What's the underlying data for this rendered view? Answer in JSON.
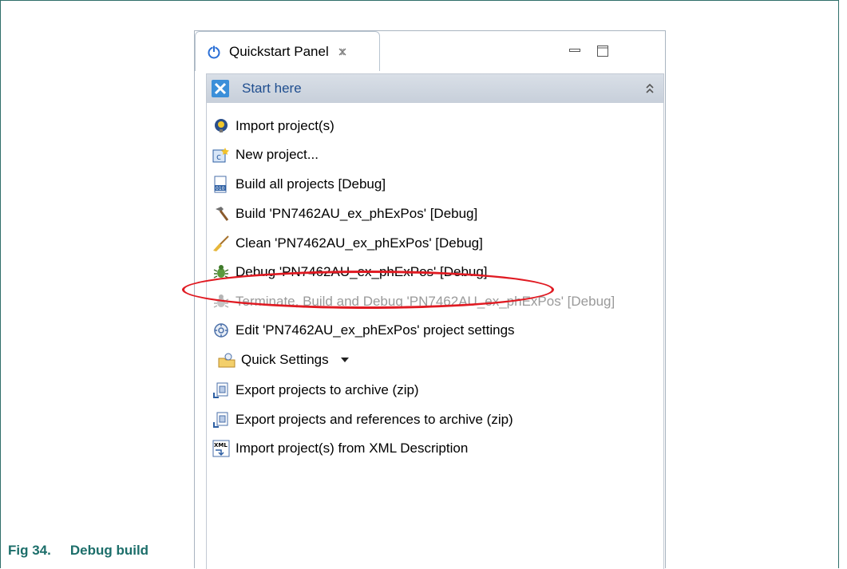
{
  "panel": {
    "tab_label": "Quickstart Panel",
    "section_label": "Start here",
    "items": [
      {
        "label": "Import project(s)",
        "icon": "import-bulb-icon",
        "disabled": false
      },
      {
        "label": "New project...",
        "icon": "new-project-icon",
        "disabled": false
      },
      {
        "label": "Build all projects [Debug]",
        "icon": "build-all-icon",
        "disabled": false
      },
      {
        "label": "Build 'PN7462AU_ex_phExPos' [Debug]",
        "icon": "hammer-icon",
        "disabled": false
      },
      {
        "label": "Clean 'PN7462AU_ex_phExPos' [Debug]",
        "icon": "broom-icon",
        "disabled": false
      },
      {
        "label": "Debug 'PN7462AU_ex_phExPos' [Debug]",
        "icon": "debug-bug-icon",
        "disabled": false
      },
      {
        "label": "Terminate, Build and Debug 'PN7462AU_ex_phExPos' [Debug]",
        "icon": "terminate-debug-icon",
        "disabled": true
      },
      {
        "label": "Edit 'PN7462AU_ex_phExPos' project settings",
        "icon": "settings-icon",
        "disabled": false
      },
      {
        "label": "Quick Settings",
        "icon": "quick-settings-icon",
        "disabled": false
      },
      {
        "label": "Export projects to archive (zip)",
        "icon": "export-archive-icon",
        "disabled": false
      },
      {
        "label": "Export projects and references to archive (zip)",
        "icon": "export-references-icon",
        "disabled": false
      },
      {
        "label": "Import project(s) from XML Description",
        "icon": "xml-import-icon",
        "disabled": false
      }
    ]
  },
  "caption": {
    "number": "Fig 34.",
    "title": "Debug build"
  },
  "colors": {
    "caption": "#1c6e6a",
    "section_label": "#1f4e8f",
    "highlight": "#e01a22"
  }
}
